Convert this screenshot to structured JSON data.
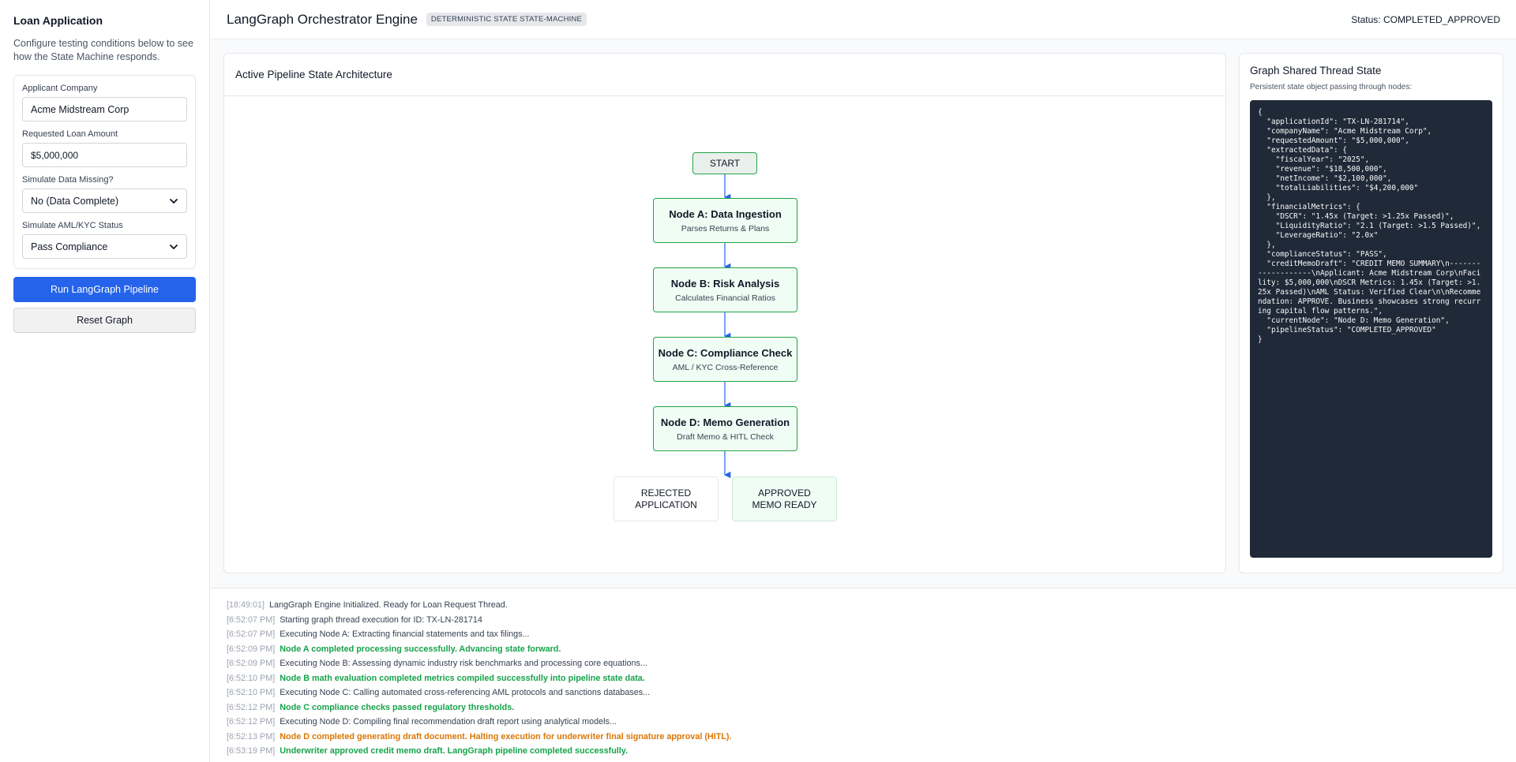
{
  "sidebar": {
    "title": "Loan Application",
    "description": "Configure testing conditions below to see how the State Machine responds.",
    "fields": {
      "company_label": "Applicant Company",
      "company_value": "Acme Midstream Corp",
      "amount_label": "Requested Loan Amount",
      "amount_value": "$5,000,000",
      "missing_label": "Simulate Data Missing?",
      "missing_value": "No (Data Complete)",
      "aml_label": "Simulate AML/KYC Status",
      "aml_value": "Pass Compliance"
    },
    "run_button": "Run LangGraph Pipeline",
    "reset_button": "Reset Graph"
  },
  "header": {
    "title": "LangGraph Orchestrator Engine",
    "badge": "DETERMINISTIC STATE STATE-MACHINE",
    "status": "Status: COMPLETED_APPROVED"
  },
  "pipeline": {
    "title": "Active Pipeline State Architecture",
    "start": "START",
    "nodes": [
      {
        "title": "Node A: Data Ingestion",
        "subtitle": "Parses Returns & Plans"
      },
      {
        "title": "Node B: Risk Analysis",
        "subtitle": "Calculates Financial Ratios"
      },
      {
        "title": "Node C: Compliance Check",
        "subtitle": "AML / KYC Cross-Reference"
      },
      {
        "title": "Node D: Memo Generation",
        "subtitle": "Draft Memo & HITL Check"
      }
    ],
    "rejected": "REJECTED APPLICATION",
    "approved": "APPROVED MEMO READY",
    "colors": {
      "node_border": "#22a447",
      "node_fill": "#f0fdf4",
      "connector": "#2563eb"
    }
  },
  "state": {
    "title": "Graph Shared Thread State",
    "description": "Persistent state object passing through nodes:",
    "json": "{\n  \"applicationId\": \"TX-LN-281714\",\n  \"companyName\": \"Acme Midstream Corp\",\n  \"requestedAmount\": \"$5,000,000\",\n  \"extractedData\": {\n    \"fiscalYear\": \"2025\",\n    \"revenue\": \"$18,500,000\",\n    \"netIncome\": \"$2,100,000\",\n    \"totalLiabilities\": \"$4,200,000\"\n  },\n  \"financialMetrics\": {\n    \"DSCR\": \"1.45x (Target: >1.25x Passed)\",\n    \"LiquidityRatio\": \"2.1 (Target: >1.5 Passed)\",\n    \"LeverageRatio\": \"2.0x\"\n  },\n  \"complianceStatus\": \"PASS\",\n  \"creditMemoDraft\": \"CREDIT MEMO SUMMARY\\n-------------------\\nApplicant: Acme Midstream Corp\\nFacility: $5,000,000\\nDSCR Metrics: 1.45x (Target: >1.25x Passed)\\nAML Status: Verified Clear\\n\\nRecommendation: APPROVE. Business showcases strong recurring capital flow patterns.\",\n  \"currentNode\": \"Node D: Memo Generation\",\n  \"pipelineStatus\": \"COMPLETED_APPROVED\"\n}"
  },
  "logs": [
    {
      "time": "[18:49:01]",
      "msg": "LangGraph Engine Initialized. Ready for Loan Request Thread.",
      "kind": "info"
    },
    {
      "time": "[6:52:07 PM]",
      "msg": "Starting graph thread execution for ID: TX-LN-281714",
      "kind": "info"
    },
    {
      "time": "[6:52:07 PM]",
      "msg": "Executing Node A: Extracting financial statements and tax filings...",
      "kind": "info"
    },
    {
      "time": "[6:52:09 PM]",
      "msg": "Node A completed processing successfully. Advancing state forward.",
      "kind": "success"
    },
    {
      "time": "[6:52:09 PM]",
      "msg": "Executing Node B: Assessing dynamic industry risk benchmarks and processing core equations...",
      "kind": "info"
    },
    {
      "time": "[6:52:10 PM]",
      "msg": "Node B math evaluation completed metrics compiled successfully into pipeline state data.",
      "kind": "success"
    },
    {
      "time": "[6:52:10 PM]",
      "msg": "Executing Node C: Calling automated cross-referencing AML protocols and sanctions databases...",
      "kind": "info"
    },
    {
      "time": "[6:52:12 PM]",
      "msg": "Node C compliance checks passed regulatory thresholds.",
      "kind": "success"
    },
    {
      "time": "[6:52:12 PM]",
      "msg": "Executing Node D: Compiling final recommendation draft report using analytical models...",
      "kind": "info"
    },
    {
      "time": "[6:52:13 PM]",
      "msg": "Node D completed generating draft document. Halting execution for underwriter final signature approval (HITL).",
      "kind": "warn"
    },
    {
      "time": "[6:53:19 PM]",
      "msg": "Underwriter approved credit memo draft. LangGraph pipeline completed successfully.",
      "kind": "success"
    }
  ]
}
